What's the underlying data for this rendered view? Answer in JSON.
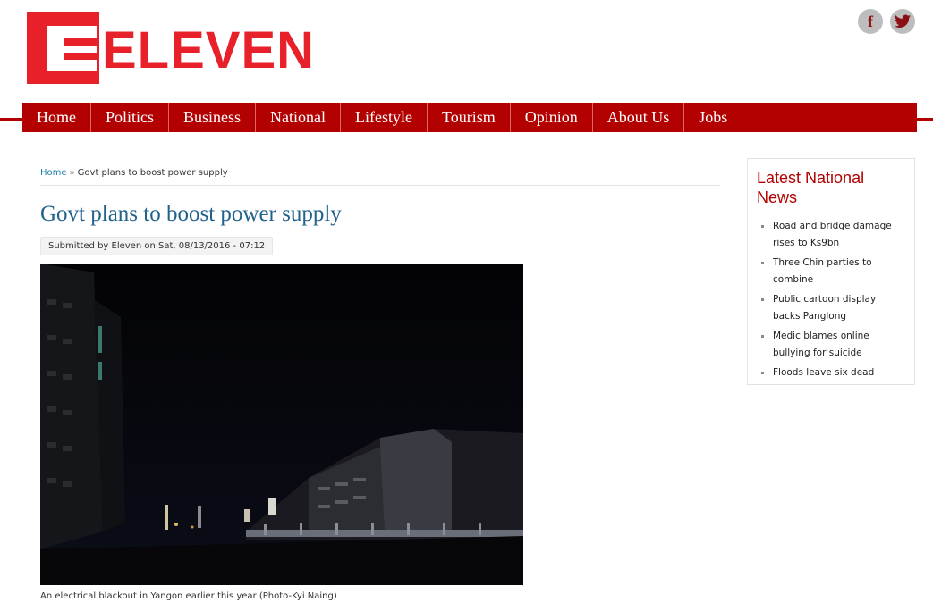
{
  "logo": {
    "text": "ELEVEN"
  },
  "social": {
    "facebook_glyph": "f",
    "twitter_glyph": "t",
    "facebook_icon": "facebook-icon",
    "twitter_icon": "twitter-icon"
  },
  "nav": [
    {
      "label": "Home"
    },
    {
      "label": "Politics"
    },
    {
      "label": "Business"
    },
    {
      "label": "National"
    },
    {
      "label": "Lifestyle"
    },
    {
      "label": "Tourism"
    },
    {
      "label": "Opinion"
    },
    {
      "label": "About Us"
    },
    {
      "label": "Jobs"
    }
  ],
  "breadcrumb": {
    "home": "Home",
    "separator": "»",
    "current": "Govt plans to boost power supply"
  },
  "article": {
    "title": "Govt plans to boost power supply",
    "submitted": "Submitted by Eleven on Sat, 08/13/2016 - 07:12",
    "caption": "An electrical blackout in Yangon earlier this year (Photo-Kyi Naing)"
  },
  "sidebar": {
    "title": "Latest National News",
    "items": [
      {
        "label": "Road and bridge damage rises to Ks9bn"
      },
      {
        "label": "Three Chin parties to combine"
      },
      {
        "label": "Public cartoon display backs Panglong"
      },
      {
        "label": "Medic blames online bullying for suicide"
      },
      {
        "label": "Floods leave six dead"
      }
    ]
  },
  "colors": {
    "brand_red": "#e8202a",
    "nav_red": "#b30000",
    "title_blue": "#21628d",
    "link_blue": "#1a7fa8"
  }
}
